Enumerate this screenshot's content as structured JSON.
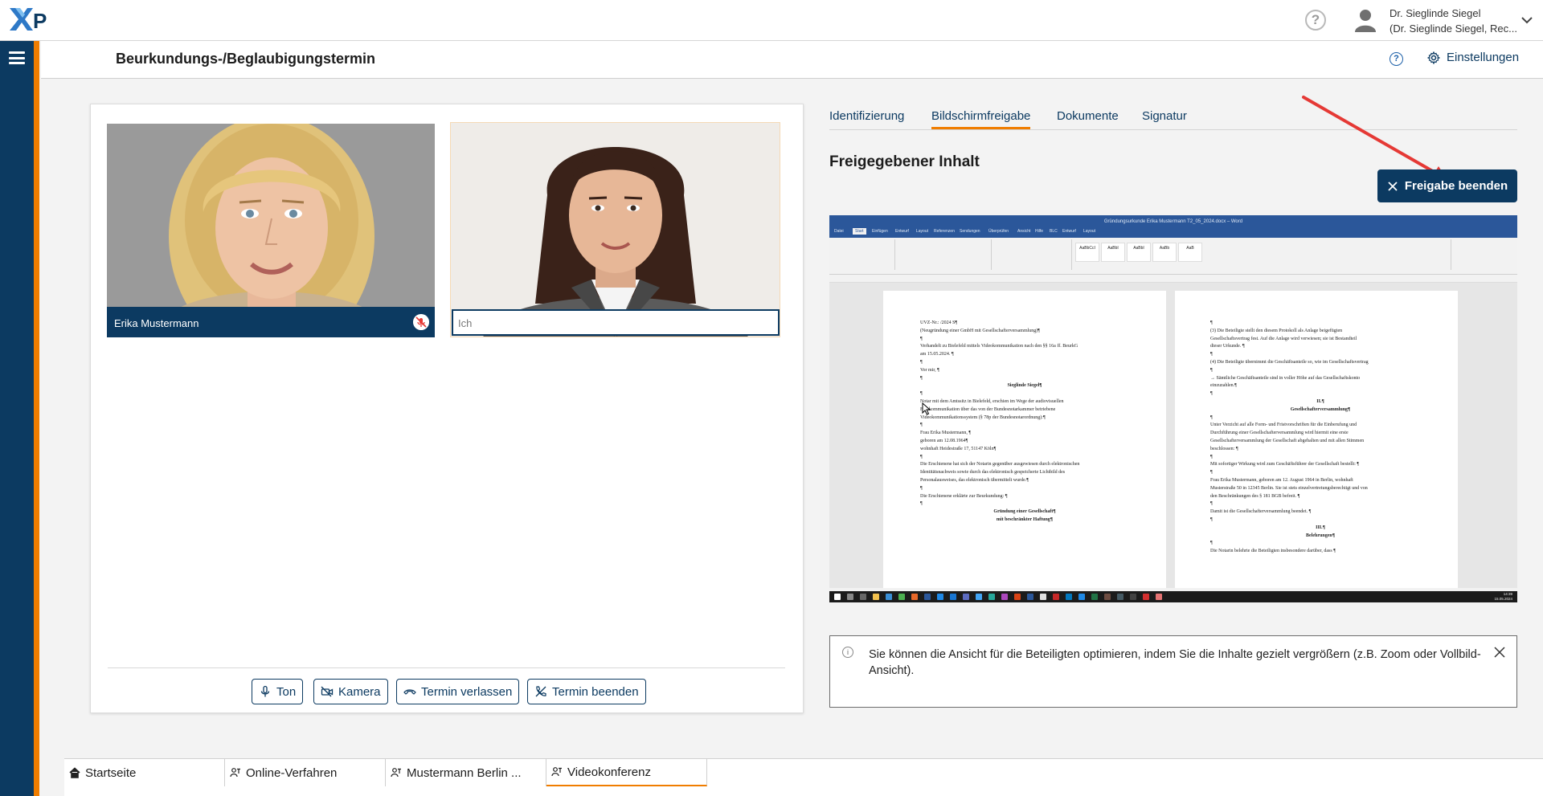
{
  "app": {
    "logo_text": "XP"
  },
  "topbar": {
    "help_glyph": "?",
    "user_name": "Dr. Sieglinde Siegel",
    "user_sub": "(Dr. Sieglinde Siegel, Rec..."
  },
  "header": {
    "title": "Beurkundungs-/Beglaubigungstermin",
    "help_glyph": "?",
    "settings_label": "Einstellungen"
  },
  "video": {
    "participant_name": "Erika Mustermann",
    "self_label": "Ich",
    "controls": [
      {
        "label": "Ton",
        "icon": "microphone-icon"
      },
      {
        "label": "Kamera",
        "icon": "camera-icon"
      },
      {
        "label": "Termin verlassen",
        "icon": "hangup-icon"
      },
      {
        "label": "Termin beenden",
        "icon": "end-call-icon"
      }
    ]
  },
  "right": {
    "tabs": [
      {
        "label": "Identifizierung",
        "active": false
      },
      {
        "label": "Bildschirmfreigabe",
        "active": true
      },
      {
        "label": "Dokumente",
        "active": false
      },
      {
        "label": "Signatur",
        "active": false
      }
    ],
    "section_title": "Freigegebener Inhalt",
    "stop_share_label": "Freigabe beenden",
    "info_icon": "i",
    "info_text": "Sie können die Ansicht für die Beteiligten optimieren, indem Sie die Inhalte gezielt vergrößern (z.B. Zoom oder Vollbild-Ansicht)."
  },
  "shared_doc": {
    "window_title": "Gründungsurkunde Erika Mustermann T2_05_2024.docx – Word",
    "tabs": [
      "Datei",
      "Start",
      "Einfügen",
      "Entwurf",
      "Layout",
      "Referenzen",
      "Sendungen",
      "Überprüfen",
      "Ansicht",
      "Hilfe",
      "BLC",
      "Entwurf",
      "Layout"
    ],
    "styles": [
      "AaBbCcI",
      "AaBbI",
      "AaBbI",
      "AaBb",
      "AaB"
    ],
    "page1": [
      "UVZ-Nr.: /2024 S¶",
      "(Neugründung einer GmbH mit Gesellschafterversammlung)¶",
      "¶",
      "Verhandelt zu Bielefeld mittels Videokommunikation nach den §§ 16a ff. BeurkG",
      "am 15.05.2024. ¶",
      "¶",
      "Vor mir, ¶",
      "¶",
      "Sieglinde Siegel¶",
      "¶",
      "Notar mit dem Amtssitz in Bielefeld, erschien im Wege der audiovisuellen",
      "Fernkommunikation über das von der Bundesnotarkammer betriebene",
      "Videokommunikationssystem (§ 78p der Bundesnotarordnung):¶",
      "¶",
      "Frau Erika Mustermann, ¶",
      "geboren am 12.08.1964¶",
      "wohnhaft Heidestraße 17, 51147 Köln¶",
      "¶",
      "Die Erschienene hat sich der Notarin gegenüber ausgewiesen durch elektronischen",
      "Identitätsnachweis sowie durch das elektronisch gespeicherte Lichtbild des",
      "Personalausweises, das elektronisch übermittelt wurde.¶",
      "¶",
      "Die Erschienene erklärte zur Beurkundung: ¶",
      "¶",
      "Gründung einer Gesellschaft¶",
      "mit beschränkter Haftung¶"
    ],
    "page2": [
      "¶",
      "(3) Die Beteiligte stellt den diesem Protokoll als Anlage beigefügten",
      "Gesellschaftsvertrag fest. Auf die Anlage wird verwiesen; sie ist Bestandteil",
      "dieser Urkunde. ¶",
      "¶",
      "(4) Die Beteiligte übernimmt die Geschäftsanteile so, wie im Gesellschaftsvertrag",
      "¶",
      "→ Sämtliche Geschäftsanteile sind in voller Höhe auf das Gesellschaftskonto",
      "einzuzahlen.¶",
      "¶",
      "II.¶",
      "Gesellschafterversammlung¶",
      "¶",
      "Unter Verzicht auf alle Form- und Fristvorschriften für die Einberufung und",
      "Durchführung einer Gesellschafterversammlung wird hiermit eine erste",
      "Gesellschafterversammlung der Gesellschaft abgehalten und mit allen Stimmen",
      "beschlossen: ¶",
      "¶",
      "Mit sofortiger Wirkung wird zum Geschäftsführer der Gesellschaft bestellt: ¶",
      "¶",
      "Frau Erika Mustermann, geboren am 12. August 1964 in Berlin, wohnhaft",
      "Musterstraße 50 in 12345 Berlin. Sie ist stets einzelvertretungsberechtigt und von",
      "den Beschränkungen des § 181 BGB befreit. ¶",
      "¶",
      "Damit ist die Gesellschafterversammlung beendet. ¶",
      "¶",
      "III.¶",
      "Belehrungen¶",
      "¶",
      "Die Notarin belehrte die Beteiligten insbesondere darüber, dass ¶"
    ],
    "taskbar_time": "14:39",
    "taskbar_date": "15.05.2024"
  },
  "bottom_tabs": [
    {
      "label": "Startseite",
      "icon": "home-icon",
      "active": false
    },
    {
      "label": "Online-Verfahren",
      "icon": "people-icon",
      "active": false
    },
    {
      "label": "Mustermann Berlin ...",
      "icon": "people-icon",
      "active": false
    },
    {
      "label": "Videokonferenz",
      "icon": "people-icon",
      "active": true
    }
  ],
  "colors": {
    "navy": "#0c3a61",
    "accent": "#f07d00",
    "word_blue": "#2b579a",
    "arrow_red": "#e53935"
  }
}
